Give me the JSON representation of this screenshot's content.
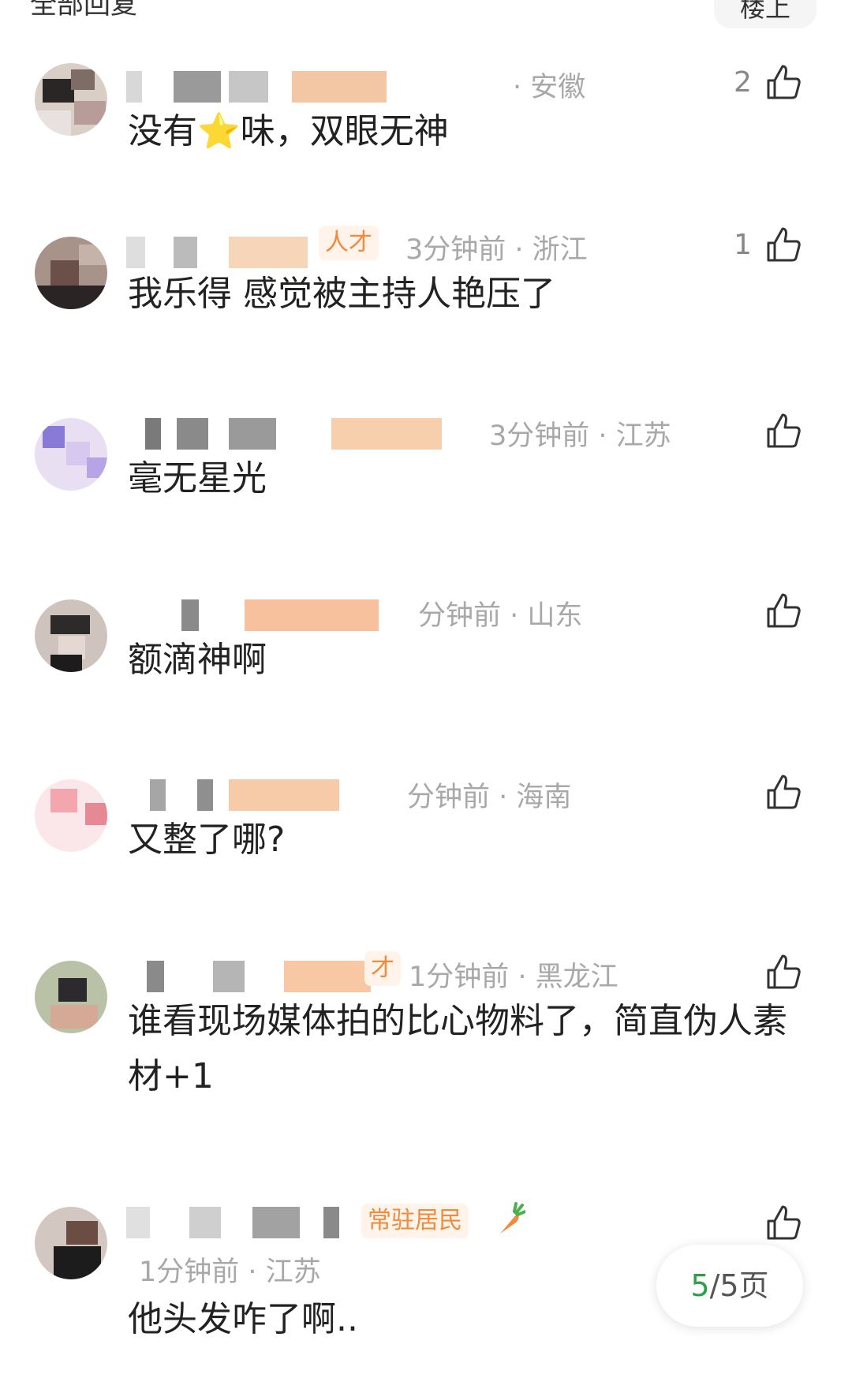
{
  "header": {
    "title": "全部回复",
    "top_button": "楼上"
  },
  "comments": [
    {
      "meta": "· 安徽",
      "likes": "2",
      "text_before": "没有",
      "emoji": "⭐",
      "text_after": "味，双眼无神"
    },
    {
      "tag": "人才",
      "meta": "3分钟前 · 浙江",
      "likes": "1",
      "text": "我乐得 感觉被主持人艳压了"
    },
    {
      "meta": "3分钟前 · 江苏",
      "likes": "",
      "text": "毫无星光"
    },
    {
      "meta": "分钟前 · 山东",
      "likes": "",
      "text": "额滴神啊"
    },
    {
      "meta": "分钟前 · 海南",
      "likes": "",
      "text": "又整了哪?"
    },
    {
      "tag": "才",
      "meta": "1分钟前 · 黑龙江",
      "likes": "",
      "text": "谁看现场媒体拍的比心物料了，简直伪人素材+1"
    },
    {
      "tag": "常驻居民",
      "badge_icon": "carrot-icon",
      "meta": "1分钟前 · 江苏",
      "likes": "",
      "text": "他头发咋了啊.."
    }
  ],
  "pagination": {
    "current": "5",
    "total_label": "/5页"
  },
  "colors": {
    "meta": "#a8a8a8",
    "tag": "#f08a3c",
    "page_current": "#2e9e4a"
  }
}
